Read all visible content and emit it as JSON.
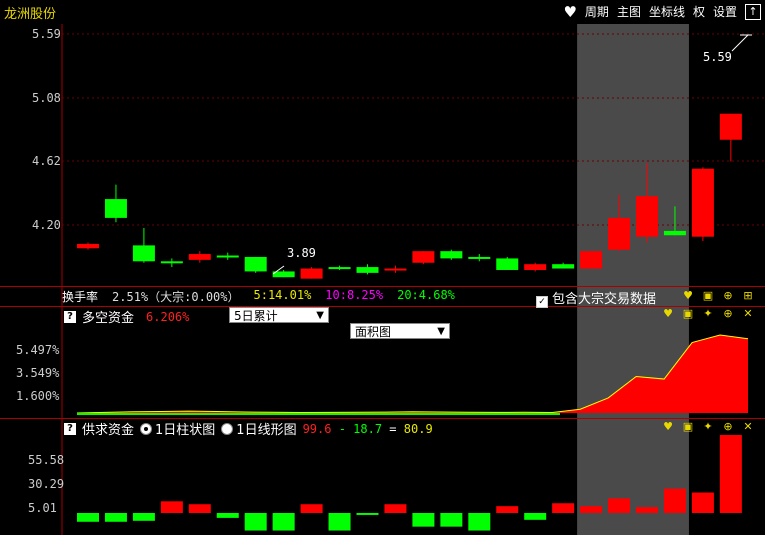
{
  "app": {
    "title": "龙洲股份"
  },
  "toolbar": {
    "period": "周期",
    "main_chart": "主图",
    "coord_line": "坐标线",
    "rights": "权",
    "settings": "设置",
    "heart_icon": "heart-icon",
    "up_icon": "up-arrow-icon"
  },
  "price_panel": {
    "y_labels": [
      "5.59",
      "5.08",
      "4.62",
      "4.20"
    ],
    "annotations": {
      "high": "5.59",
      "low": "3.89"
    },
    "candles": [
      {
        "o": 4.08,
        "c": 4.11,
        "h": 4.12,
        "l": 4.07
      },
      {
        "o": 4.42,
        "c": 4.29,
        "h": 4.52,
        "l": 4.26
      },
      {
        "o": 4.1,
        "c": 3.99,
        "h": 4.22,
        "l": 3.98
      },
      {
        "o": 3.99,
        "c": 3.98,
        "h": 4.01,
        "l": 3.95
      },
      {
        "o": 4.0,
        "c": 4.04,
        "h": 4.06,
        "l": 3.98
      },
      {
        "o": 4.03,
        "c": 4.02,
        "h": 4.05,
        "l": 4.0
      },
      {
        "o": 4.02,
        "c": 3.92,
        "h": 4.02,
        "l": 3.91
      },
      {
        "o": 3.92,
        "c": 3.88,
        "h": 3.93,
        "l": 3.88
      },
      {
        "o": 3.87,
        "c": 3.94,
        "h": 3.95,
        "l": 3.87
      },
      {
        "o": 3.95,
        "c": 3.94,
        "h": 3.96,
        "l": 3.93
      },
      {
        "o": 3.95,
        "c": 3.91,
        "h": 3.97,
        "l": 3.9
      },
      {
        "o": 3.94,
        "c": 3.94,
        "h": 3.96,
        "l": 3.91
      },
      {
        "o": 3.98,
        "c": 4.06,
        "h": 4.06,
        "l": 3.97
      },
      {
        "o": 4.06,
        "c": 4.01,
        "h": 4.07,
        "l": 4.0
      },
      {
        "o": 4.02,
        "c": 4.01,
        "h": 4.04,
        "l": 3.99
      },
      {
        "o": 4.01,
        "c": 3.93,
        "h": 4.02,
        "l": 3.93
      },
      {
        "o": 3.93,
        "c": 3.97,
        "h": 3.98,
        "l": 3.92
      },
      {
        "o": 3.97,
        "c": 3.94,
        "h": 3.98,
        "l": 3.94
      },
      {
        "o": 3.94,
        "c": 4.06,
        "h": 4.06,
        "l": 3.94
      },
      {
        "o": 4.07,
        "c": 4.29,
        "h": 4.45,
        "l": 4.06
      },
      {
        "o": 4.16,
        "c": 4.44,
        "h": 4.67,
        "l": 4.12
      },
      {
        "o": 4.2,
        "c": 4.17,
        "h": 4.37,
        "l": 4.17
      },
      {
        "o": 4.16,
        "c": 4.63,
        "h": 4.64,
        "l": 4.13
      },
      {
        "o": 4.83,
        "c": 5.01,
        "h": 5.01,
        "l": 4.68
      }
    ]
  },
  "info_bar": {
    "turnover_label": "换手率",
    "turnover_value": "2.51%（大宗:0.00%）",
    "t5": "5:14.01%",
    "t10": "10:8.25%",
    "t20": "20:4.68%",
    "checkbox_label": "包含大宗交易数据",
    "checkbox_checked": true
  },
  "panel2": {
    "title": "多空资金",
    "value": "6.206%",
    "select1": "5日累计",
    "select2": "面积图",
    "y_labels": [
      "5.497%",
      "3.549%",
      "1.600%"
    ],
    "area_values": [
      0.0,
      0.05,
      0.1,
      0.12,
      0.15,
      0.12,
      0.08,
      0.06,
      0.04,
      0.05,
      0.06,
      0.07,
      0.1,
      0.08,
      0.06,
      0.05,
      0.06,
      0.04,
      0.3,
      1.2,
      2.9,
      2.7,
      5.6,
      6.2,
      5.9
    ],
    "colors": {
      "pos": "#ff0000",
      "line_pos": "#ffff00",
      "line_neg": "#00ff00"
    }
  },
  "panel3": {
    "title": "供求资金",
    "radio1": "1日柱状图",
    "radio2": "1日线形图",
    "formula_a": "99.6",
    "formula_op1": " - ",
    "formula_b": "18.7",
    "formula_op2": " = ",
    "formula_c": "80.9",
    "y_labels": [
      "55.58",
      "30.29",
      "5.01"
    ],
    "bar_values": [
      -9,
      -9,
      -8,
      12,
      9,
      -5,
      -18,
      -18,
      9,
      -18,
      -2,
      9,
      -14,
      -14,
      -18,
      7,
      -7,
      10,
      7,
      15,
      6,
      25,
      21,
      80
    ],
    "colors": {
      "up": "#ff0000",
      "down": "#00ff00"
    }
  },
  "highlight": {
    "from_index": 18,
    "to_index": 21
  }
}
